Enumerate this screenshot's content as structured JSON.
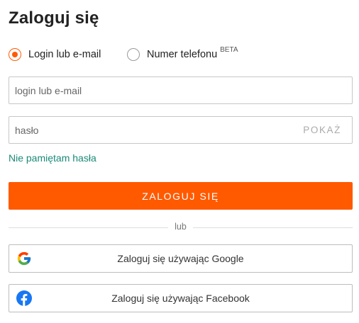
{
  "title": "Zaloguj się",
  "login_method": {
    "options": [
      {
        "label": "Login lub e-mail",
        "selected": true
      },
      {
        "label": "Numer telefonu",
        "badge": "BETA",
        "selected": false
      }
    ]
  },
  "username": {
    "placeholder": "login lub e-mail",
    "value": ""
  },
  "password": {
    "placeholder": "hasło",
    "value": "",
    "show_label": "POKAŻ"
  },
  "forgot_password": "Nie pamiętam hasła",
  "submit_label": "ZALOGUJ SIĘ",
  "divider_text": "lub",
  "social": {
    "google_label": "Zaloguj się używając Google",
    "facebook_label": "Zaloguj się używając Facebook"
  },
  "colors": {
    "accent": "#ff5a00",
    "link": "#1b8a78",
    "facebook": "#1877f2"
  },
  "icons": {
    "google": "google-g-icon",
    "facebook": "facebook-f-icon"
  }
}
